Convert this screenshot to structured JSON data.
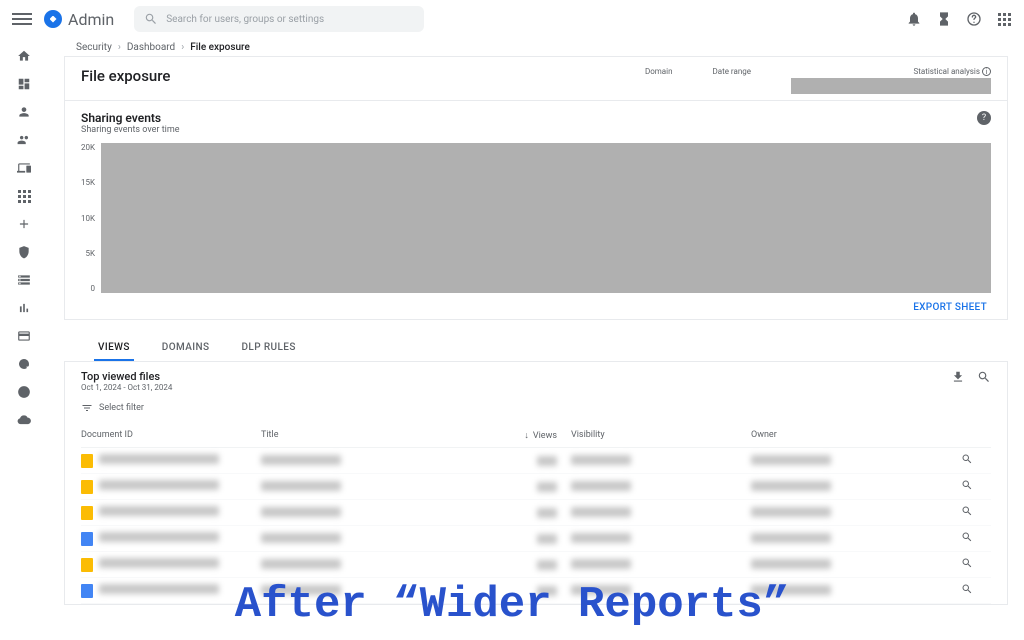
{
  "topbar": {
    "app_name": "Admin",
    "search_placeholder": "Search for users, groups or settings"
  },
  "breadcrumb": {
    "items": [
      "Security",
      "Dashboard"
    ],
    "current": "File exposure"
  },
  "leftrail_icons": [
    "home",
    "dashboard",
    "person",
    "group",
    "devices",
    "apps",
    "add",
    "security",
    "billing",
    "reports",
    "card",
    "alt",
    "support",
    "cloud"
  ],
  "page": {
    "title": "File exposure",
    "filters": {
      "domain": "Domain",
      "date_range": "Date range",
      "stat": "Statistical analysis"
    }
  },
  "card": {
    "title": "Sharing events",
    "subtitle": "Sharing events over time",
    "export": "EXPORT SHEET"
  },
  "chart_data": {
    "type": "area",
    "title": "Sharing events over time",
    "y_ticks": [
      "20K",
      "15K",
      "10K",
      "5K",
      "0"
    ],
    "ylim": [
      0,
      20000
    ],
    "note": "chart body obscured in source; actual series values unreadable"
  },
  "tabs": [
    {
      "label": "VIEWS",
      "active": true
    },
    {
      "label": "DOMAINS",
      "active": false
    },
    {
      "label": "DLP RULES",
      "active": false
    }
  ],
  "table": {
    "title": "Top viewed files",
    "subtitle": "Oct 1, 2024 - Oct 31, 2024",
    "filter_label": "Select filter",
    "columns": {
      "doc": "Document ID",
      "title": "Title",
      "views": "Views",
      "visibility": "Visibility",
      "owner": "Owner"
    },
    "rows": [
      {
        "icon": "yellow"
      },
      {
        "icon": "yellow"
      },
      {
        "icon": "yellow"
      },
      {
        "icon": "blue"
      },
      {
        "icon": "yellow"
      },
      {
        "icon": "blue"
      }
    ]
  },
  "caption": "After “Wider Reports”"
}
